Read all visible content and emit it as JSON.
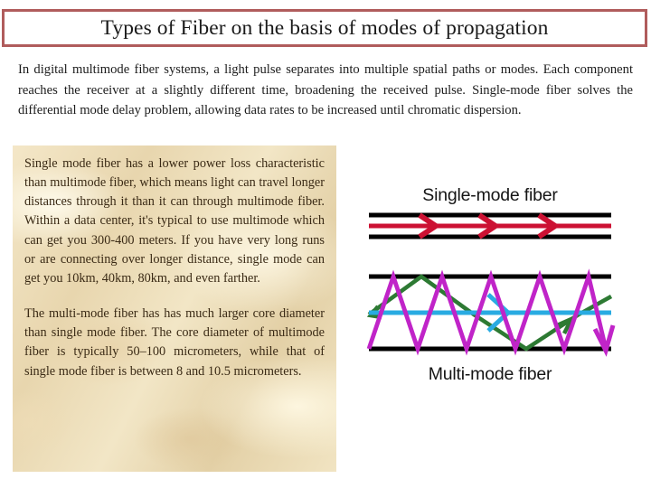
{
  "slide": {
    "title": "Types of Fiber on the basis of modes of propagation",
    "title_border_color": "#b05c5c",
    "background_color": "#ffffff"
  },
  "intro": {
    "paragraph": "In digital multimode fiber systems, a light pulse separates into multiple spatial paths or modes. Each component reaches the receiver at a slightly different time, broadening the received pulse. Single-mode fiber solves the differential mode delay problem, allowing data rates to be increased until chromatic dispersion."
  },
  "parchment_box": {
    "background_color": "#efdfbc",
    "text_color": "#3a2a15",
    "paragraphs": [
      "Single mode fiber has a lower power loss characteristic than multimode fiber, which means light can travel longer distances through it than it can through multimode fiber. Within a data center, it's typical to use multimode which can get you 300-400 meters. If you have very long runs or are connecting over longer distance, single mode can get you 10km, 40km, 80km, and even farther.",
      "The multi-mode fiber has has much larger core diameter than single mode fiber. The core diameter of multimode fiber is typically 50–100 micrometers, while that of single mode fiber is between 8 and 10.5 micrometers."
    ]
  },
  "diagram": {
    "single_mode": {
      "label": "Single-mode fiber",
      "cladding_color": "#000000",
      "ray_color": "#cc1133",
      "ray_count": 1,
      "arrow_count": 3
    },
    "multi_mode": {
      "label": "Multi-mode fiber",
      "cladding_color": "#000000",
      "rays": [
        {
          "name": "high-angle-mode",
          "color": "#c024c8",
          "path": "zigzag-steep",
          "bounces": 9
        },
        {
          "name": "low-angle-mode",
          "color": "#2d7a33",
          "path": "zigzag-shallow",
          "bounces": 4
        },
        {
          "name": "axial-mode",
          "color": "#29abe2",
          "path": "straight",
          "bounces": 0
        }
      ]
    }
  }
}
